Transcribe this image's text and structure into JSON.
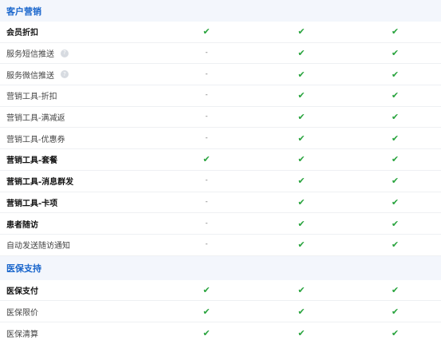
{
  "sections": [
    {
      "title": "客户营销",
      "rows": [
        {
          "label": "会员折扣",
          "bold": true,
          "help": false,
          "values": [
            "✔",
            "✔",
            "✔"
          ]
        },
        {
          "label": "服务短信推送",
          "bold": false,
          "help": true,
          "values": [
            "-",
            "✔",
            "✔"
          ]
        },
        {
          "label": "服务微信推送",
          "bold": false,
          "help": true,
          "values": [
            "-",
            "✔",
            "✔"
          ]
        },
        {
          "label": "营销工具-折扣",
          "bold": false,
          "help": false,
          "values": [
            "-",
            "✔",
            "✔"
          ]
        },
        {
          "label": "营销工具-满减返",
          "bold": false,
          "help": false,
          "values": [
            "-",
            "✔",
            "✔"
          ]
        },
        {
          "label": "营销工具-优惠券",
          "bold": false,
          "help": false,
          "values": [
            "-",
            "✔",
            "✔"
          ]
        },
        {
          "label": "营销工具-套餐",
          "bold": true,
          "help": false,
          "values": [
            "✔",
            "✔",
            "✔"
          ]
        },
        {
          "label": "营销工具-消息群发",
          "bold": true,
          "help": false,
          "values": [
            "-",
            "✔",
            "✔"
          ]
        },
        {
          "label": "营销工具-卡项",
          "bold": true,
          "help": false,
          "values": [
            "-",
            "✔",
            "✔"
          ]
        },
        {
          "label": "患者随访",
          "bold": true,
          "help": false,
          "values": [
            "-",
            "✔",
            "✔"
          ]
        },
        {
          "label": "自动发送随访通知",
          "bold": false,
          "help": false,
          "values": [
            "-",
            "✔",
            "✔"
          ]
        }
      ]
    },
    {
      "title": "医保支持",
      "rows": [
        {
          "label": "医保支付",
          "bold": true,
          "help": false,
          "values": [
            "✔",
            "✔",
            "✔"
          ]
        },
        {
          "label": "医保限价",
          "bold": false,
          "help": false,
          "values": [
            "✔",
            "✔",
            "✔"
          ]
        },
        {
          "label": "医保清算",
          "bold": false,
          "help": false,
          "values": [
            "✔",
            "✔",
            "✔"
          ]
        }
      ]
    }
  ],
  "icons": {
    "help": "?",
    "help_name": "help-circle-icon"
  },
  "colors": {
    "section_title": "#1a66cc",
    "section_bg": "#f3f6fc",
    "check": "#25a23a",
    "divider": "#eef0f3"
  }
}
